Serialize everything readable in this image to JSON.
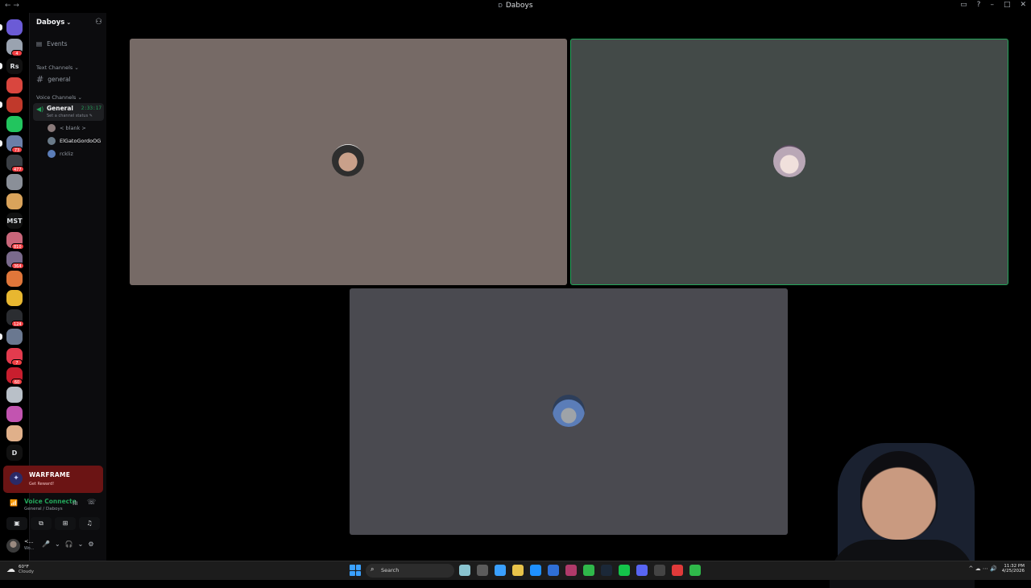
{
  "window": {
    "title": "Daboys",
    "nav_glyph": "←  →"
  },
  "window_controls": {
    "inbox": "▭",
    "help": "?",
    "min": "–",
    "max": "□",
    "close": "✕"
  },
  "rail": {
    "servers": [
      {
        "name": "server-1",
        "color": "#6b5bd6",
        "badge": ""
      },
      {
        "name": "server-2",
        "color": "#9aa3b0",
        "badge": "4"
      },
      {
        "name": "server-rs",
        "color": "#111111",
        "badge": "",
        "text": "Rs"
      },
      {
        "name": "server-4",
        "color": "#d9463e",
        "badge": ""
      },
      {
        "name": "server-5",
        "color": "#c0392b",
        "badge": ""
      },
      {
        "name": "server-6",
        "color": "#22c55e",
        "badge": ""
      },
      {
        "name": "server-7",
        "color": "#6b7fa8",
        "badge": "73"
      },
      {
        "name": "server-8",
        "color": "#3b3f45",
        "badge": "477"
      },
      {
        "name": "server-9",
        "color": "#8a8f98",
        "badge": ""
      },
      {
        "name": "server-10",
        "color": "#d9a35b",
        "badge": ""
      },
      {
        "name": "server-mst",
        "color": "#111111",
        "badge": "",
        "text": "MST"
      },
      {
        "name": "server-12",
        "color": "#c9667a",
        "badge": "810"
      },
      {
        "name": "server-13",
        "color": "#7a6a8c",
        "badge": "364"
      },
      {
        "name": "server-14",
        "color": "#e0763a",
        "badge": ""
      },
      {
        "name": "server-15",
        "color": "#e8b730",
        "badge": ""
      },
      {
        "name": "server-16",
        "color": "#2b2d31",
        "badge": "124"
      },
      {
        "name": "server-17",
        "color": "#6a7890",
        "badge": ""
      },
      {
        "name": "server-18",
        "color": "#e33b4e",
        "badge": "7"
      },
      {
        "name": "server-19",
        "color": "#c81e2e",
        "badge": "60"
      },
      {
        "name": "server-20",
        "color": "#b9c0c8",
        "badge": ""
      },
      {
        "name": "server-21",
        "color": "#c254b0",
        "badge": ""
      },
      {
        "name": "server-22",
        "color": "#e0b08a",
        "badge": ""
      },
      {
        "name": "server-23",
        "color": "#3b6fd6",
        "badge": "",
        "text": "D"
      }
    ]
  },
  "sidebar": {
    "guild_name": "Daboys",
    "guild_chevron": "⌄",
    "invite_glyph": "⚇",
    "events_icon": "▤",
    "events_label": "Events",
    "text_category": "Text Channels",
    "text_channel": "general",
    "voice_category": "Voice Channels",
    "voice_channel": {
      "name": "General",
      "timer": "2:33:17",
      "status": "Set a channel status"
    },
    "voice_users": [
      {
        "name": "< blank >",
        "color": "#8a7a7a",
        "bright": false
      },
      {
        "name": "ElGatoGordoOG",
        "color": "#6a7a88",
        "bright": true
      },
      {
        "name": "rckliz",
        "color": "#5b7db8",
        "bright": false
      }
    ]
  },
  "promo": {
    "icon": "✦",
    "title": "WARFRAME",
    "subtitle": "Get Reward!"
  },
  "voice_panel": {
    "signal_icon": "📶",
    "title": "Voice Connecte",
    "subtitle": "General / Daboys",
    "noise_icon": "ılı",
    "hangup_icon": "☏",
    "buttons": [
      {
        "name": "camera-off-button",
        "icon": "▣"
      },
      {
        "name": "screen-share-button",
        "icon": "⧉"
      },
      {
        "name": "activities-button",
        "icon": "⊞"
      },
      {
        "name": "soundboard-button",
        "icon": "♫"
      }
    ]
  },
  "user": {
    "name": "<...",
    "status": "Wo...",
    "mic_icon": "🎤",
    "headset_icon": "🎧",
    "settings_icon": "⚙",
    "chevron": "⌄"
  },
  "stage": {
    "tiles": [
      {
        "name": "participant-tile-blank",
        "color": "#766a66",
        "speaking": false
      },
      {
        "name": "participant-tile-elgatogordoog",
        "color": "#434a48",
        "speaking": true
      },
      {
        "name": "participant-tile-rckliz",
        "color": "#4a4a50",
        "speaking": false
      }
    ]
  },
  "taskbar": {
    "weather": {
      "icon": "☁",
      "temp": "60°F",
      "condition": "Cloudy"
    },
    "search_icon": "⌕",
    "search_label": "Search",
    "apps": [
      "#8ac4d0",
      "#5b5b5b",
      "#3aa0ff",
      "#e8c34a",
      "#1e90ff",
      "#2f6fd6",
      "#b03a6a",
      "#2fb84a",
      "#1b2838",
      "#14c44a",
      "#5865f2",
      "#444444",
      "#e03a3a",
      "#2fb84a"
    ],
    "tray_icons": "^  ☁  ⋯  🔊",
    "time": "11:32 PM",
    "date": "4/25/2026"
  }
}
